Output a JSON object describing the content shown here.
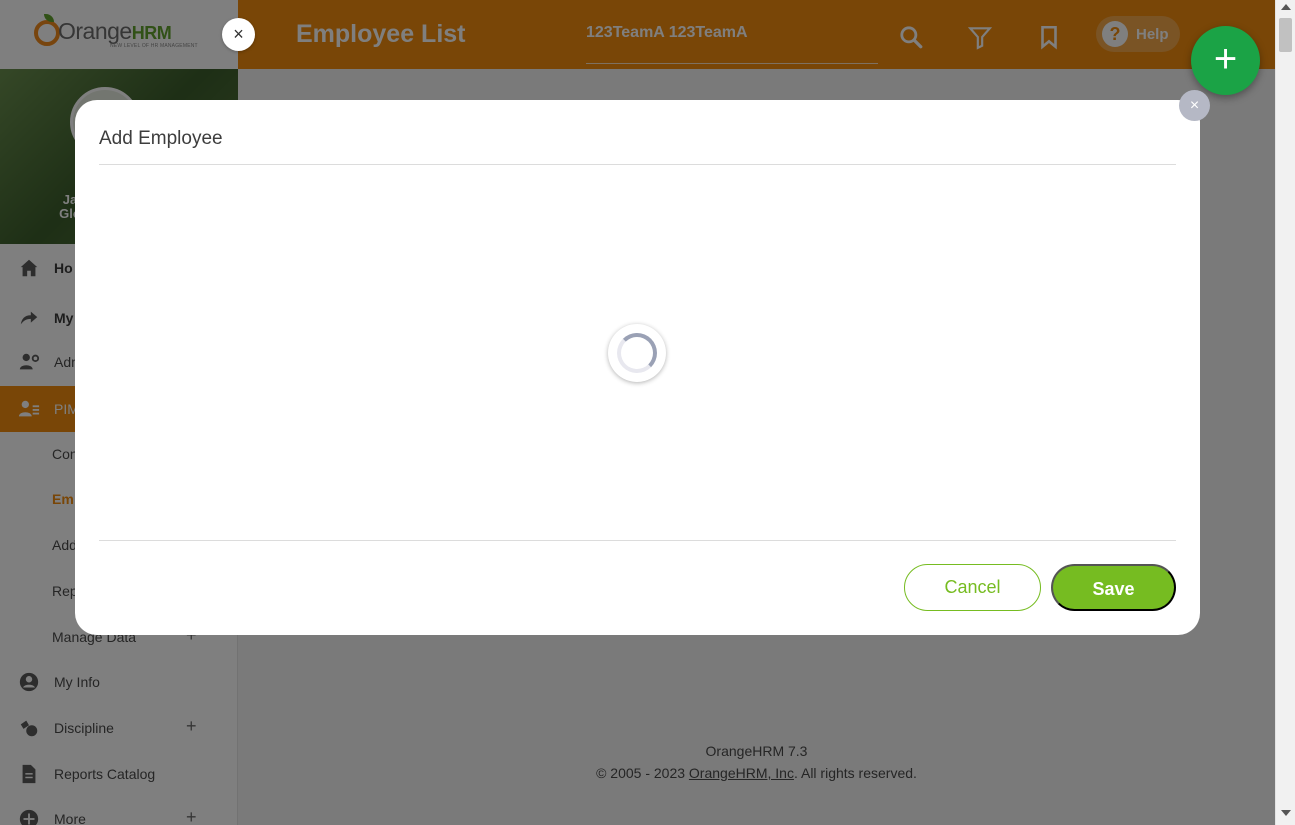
{
  "app": {
    "logo_text": "Orange",
    "logo_text_accent": "HRM",
    "logo_tagline": "NEW LEVEL OF HR MANAGEMENT"
  },
  "profile": {
    "name_line1": "Ja",
    "name_line2": "Glo"
  },
  "sidebar": {
    "items": [
      {
        "label": "Ho",
        "icon": "home-icon"
      },
      {
        "label": "My",
        "icon": "share-arrow-icon"
      },
      {
        "label": "Adm",
        "icon": "admin-user-icon"
      },
      {
        "label": "PIM",
        "icon": "pim-users-icon"
      }
    ],
    "pim_subitems": [
      "Con",
      "Em",
      "Add",
      "Rep",
      "Manage Data"
    ],
    "lower_items": [
      {
        "label": "My Info",
        "icon": "user-circle-icon"
      },
      {
        "label": "Discipline",
        "icon": "discipline-icon"
      },
      {
        "label": "Reports Catalog",
        "icon": "document-icon"
      },
      {
        "label": "More",
        "icon": "plus-circle-icon"
      }
    ],
    "expand_symbol": "+"
  },
  "header": {
    "title": "Employee List",
    "search_value": "123TeamA  123TeamA",
    "help_label": "Help",
    "help_glyph": "?"
  },
  "fab_symbol": "+",
  "modal": {
    "title": "Add Employee",
    "close_symbol": "×",
    "cancel_label": "Cancel",
    "save_label": "Save",
    "loading": true
  },
  "footer": {
    "version": "OrangeHRM 7.3",
    "copyright_prefix": "© 2005 - 2023 ",
    "company_link": "OrangeHRM, Inc",
    "copyright_suffix": ". All rights reserved."
  },
  "sidebar_close_symbol": "×",
  "colors": {
    "brand_orange": "#f28c0f",
    "brand_green": "#76bc21",
    "fab_green": "#1ba346"
  }
}
